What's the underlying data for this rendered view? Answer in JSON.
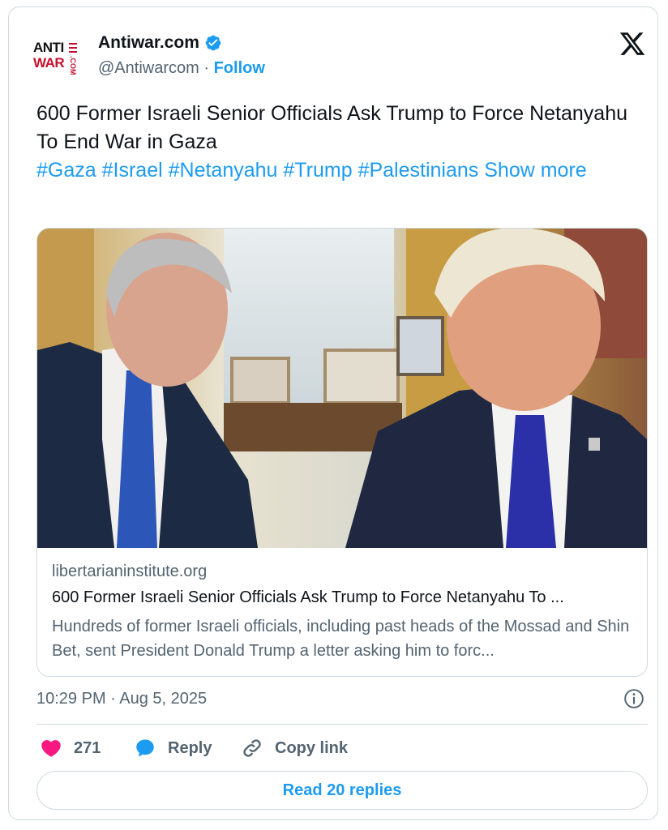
{
  "account": {
    "name": "Antiwar.com",
    "handle": "@Antiwarcom",
    "separator": "·",
    "follow_label": "Follow",
    "logo_line1": "ANTI",
    "logo_line2": "WAR",
    "logo_suffix": ".COM"
  },
  "tweet": {
    "text": "600 Former Israeli Senior Officials Ask Trump to Force Netanyahu To End War in Gaza",
    "hashtags": [
      "#Gaza",
      "#Israel",
      "#Netanyahu",
      "#Trump",
      "#Palestinians"
    ],
    "show_more": "Show more"
  },
  "link_card": {
    "domain": "libertarianinstitute.org",
    "title": "600 Former Israeli Senior Officials Ask Trump to Force Netanyahu To ...",
    "description": "Hundreds of former Israeli officials, including past heads of the Mossad and Shin Bet, sent President Donald Trump a letter asking him to forc..."
  },
  "meta": {
    "timestamp": "10:29 PM · Aug 5, 2025"
  },
  "actions": {
    "likes_count": "271",
    "reply_label": "Reply",
    "copy_link_label": "Copy link",
    "read_replies_label": "Read 20 replies"
  },
  "colors": {
    "accent": "#1d9bf0",
    "like": "#f91880",
    "secondary_text": "#536471",
    "border": "#cfd9de"
  },
  "icons": [
    "verified-badge-icon",
    "x-logo-icon",
    "info-icon",
    "heart-icon",
    "reply-bubble-icon",
    "link-icon"
  ]
}
